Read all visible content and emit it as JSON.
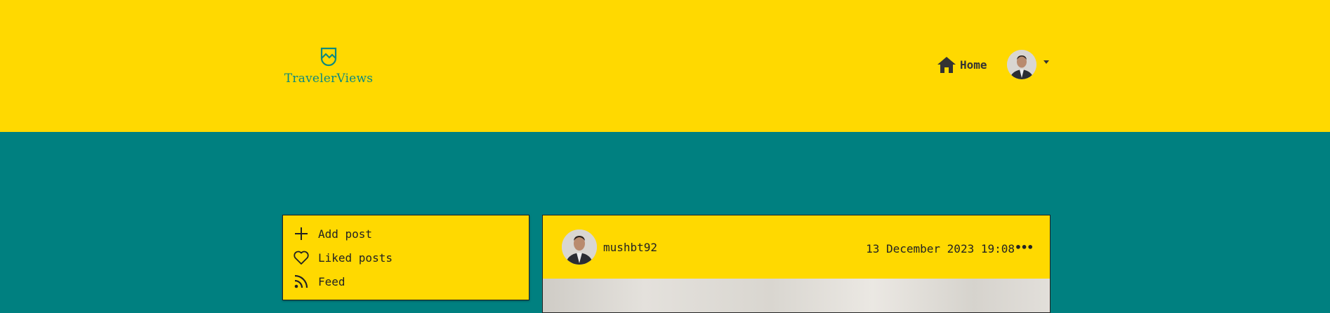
{
  "header": {
    "brand": "TravelerViews",
    "nav": {
      "home_label": "Home"
    },
    "user_menu": {
      "avatar_alt": "user avatar"
    }
  },
  "sidebar": {
    "items": [
      {
        "label": "Add post",
        "icon": "plus-icon"
      },
      {
        "label": "Liked posts",
        "icon": "heart-icon"
      },
      {
        "label": "Feed",
        "icon": "rss-icon"
      }
    ]
  },
  "post": {
    "username": "mushbt92",
    "date": "13 December 2023 19:08",
    "more_label": "•••"
  },
  "colors": {
    "header_bg": "#ffd900",
    "page_bg": "#008080",
    "brand": "#0e8a7e",
    "text": "#222222"
  }
}
